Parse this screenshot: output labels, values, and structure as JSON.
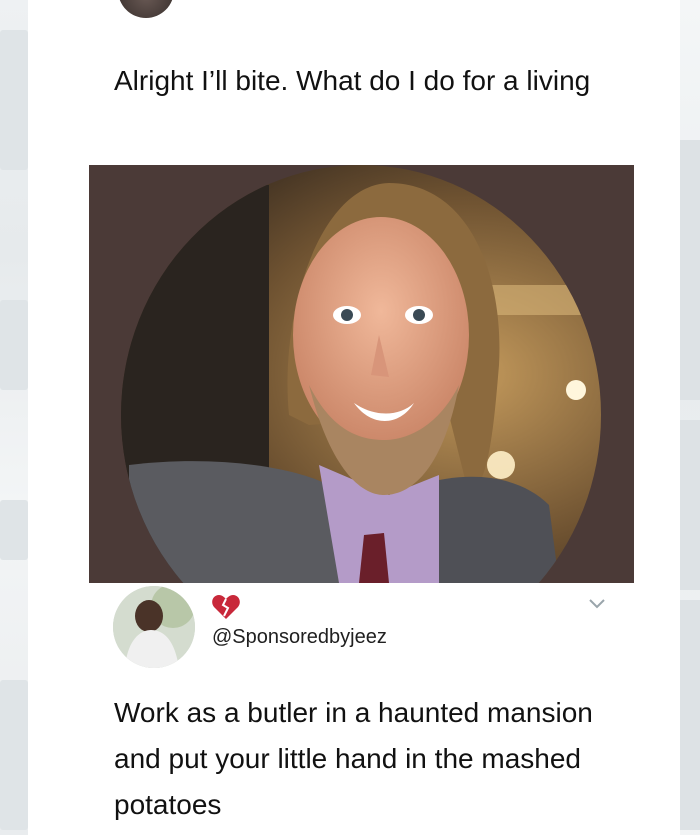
{
  "original_tweet": {
    "text": "Alright I’ll bite. What do I do for a living"
  },
  "reply": {
    "handle": "@Sponsoredbyjeez",
    "badge_icon": "broken-heart-icon",
    "menu_icon": "chevron-down-icon",
    "text": "Work as a butler in a haunted mansion and put your little hand in the mashed potatoes"
  },
  "colors": {
    "photo_background": "#4b3a37",
    "broken_heart": "#c8283a",
    "chevron": "#9aa5ab"
  }
}
